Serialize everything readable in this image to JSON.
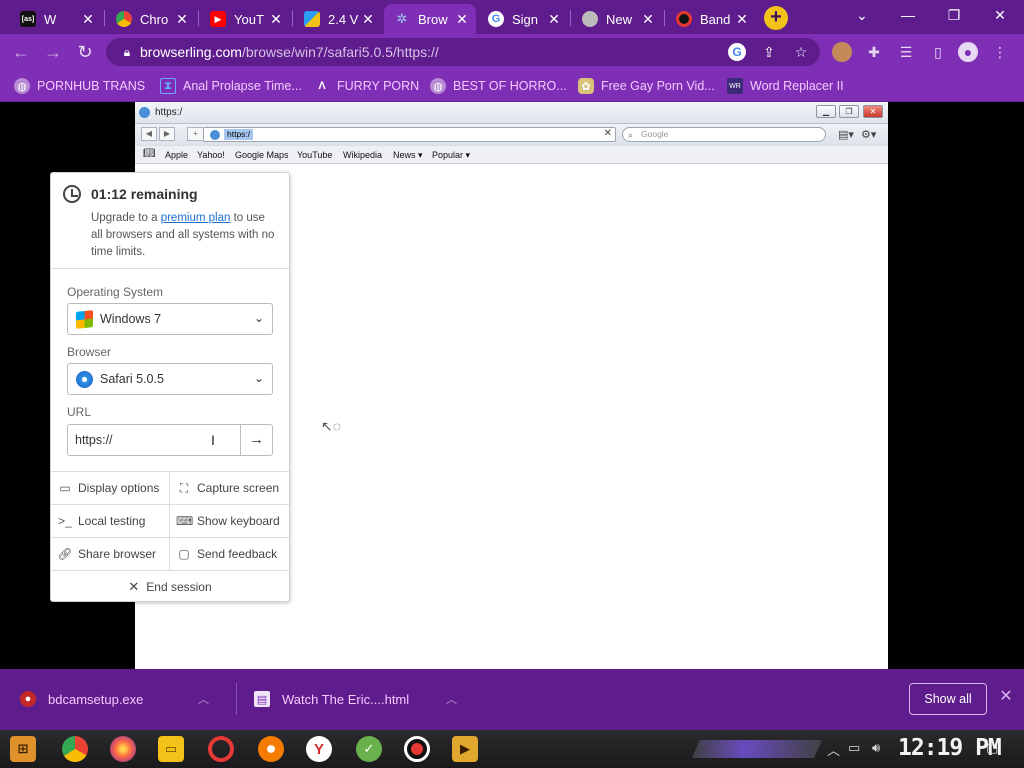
{
  "tabs": [
    {
      "label": "W",
      "favicon": "[as]",
      "color": "#111111"
    },
    {
      "label": "Chro",
      "favicon": "chrome",
      "color": "#ea4335"
    },
    {
      "label": "YouT",
      "favicon": "youtube",
      "color": "#ff0000"
    },
    {
      "label": "2.4 V",
      "favicon": "squares",
      "color": "#2a9df4"
    },
    {
      "label": "Brow",
      "favicon": "browserling",
      "color": "#7fb3e6"
    },
    {
      "label": "Sign",
      "favicon": "G",
      "color": "#4285f4"
    },
    {
      "label": "New",
      "favicon": "chrome",
      "color": "#888888"
    },
    {
      "label": "Band",
      "favicon": "record",
      "color": "#e53935"
    }
  ],
  "new_tab_label": "+",
  "window_controls": {
    "minimize": "—",
    "maximize": "❐",
    "close": "✕",
    "tab_search": "⌄"
  },
  "address": {
    "host": "browserling.com",
    "path": "/browse/win7/safari5.0.5/https://"
  },
  "bookmarks": [
    {
      "label": "PORNHUB TRANS",
      "icon": "globe-icon"
    },
    {
      "label": "Anal Prolapse Time...",
      "icon": "hourglass-icon"
    },
    {
      "label": "FURRY PORN",
      "icon": "lambda-icon"
    },
    {
      "label": "BEST OF HORRO...",
      "icon": "globe-icon"
    },
    {
      "label": "Free Gay Porn Vid...",
      "icon": "badge-icon"
    },
    {
      "label": "Word Replacer II",
      "icon": "wr-icon"
    }
  ],
  "remote": {
    "title": "https:/",
    "address": "https:/",
    "search_placeholder": "Google",
    "bookmarks": [
      "Apple",
      "Yahoo!",
      "Google Maps",
      "YouTube",
      "Wikipedia",
      "News ▾",
      "Popular ▾"
    ]
  },
  "panel": {
    "timer": "01:12 remaining",
    "upgrade_pre": "Upgrade to a",
    "upgrade_link": "premium plan",
    "upgrade_post": "to use all browsers and all systems with no time limits.",
    "os_label": "Operating System",
    "os_value": "Windows 7",
    "browser_label": "Browser",
    "browser_value": "Safari 5.0.5",
    "url_label": "URL",
    "url_value": "https://",
    "actions": {
      "display_options": "Display options",
      "capture_screen": "Capture screen",
      "local_testing": "Local testing",
      "show_keyboard": "Show keyboard",
      "share_browser": "Share browser",
      "send_feedback": "Send feedback",
      "end_session": "End session"
    }
  },
  "downloads": [
    {
      "name": "bdcamsetup.exe",
      "icon": "bandicam-icon"
    },
    {
      "name": "Watch The Eric....html",
      "icon": "html-file-icon"
    }
  ],
  "downloads_show_all": "Show all",
  "taskbar_clock": "12:19 PM",
  "colors": {
    "chrome_frame": "#5e1c8c",
    "chrome_toolbar": "#7e2fb5",
    "bookmark_text": "#f5c9ff",
    "link": "#1a6fd0"
  }
}
